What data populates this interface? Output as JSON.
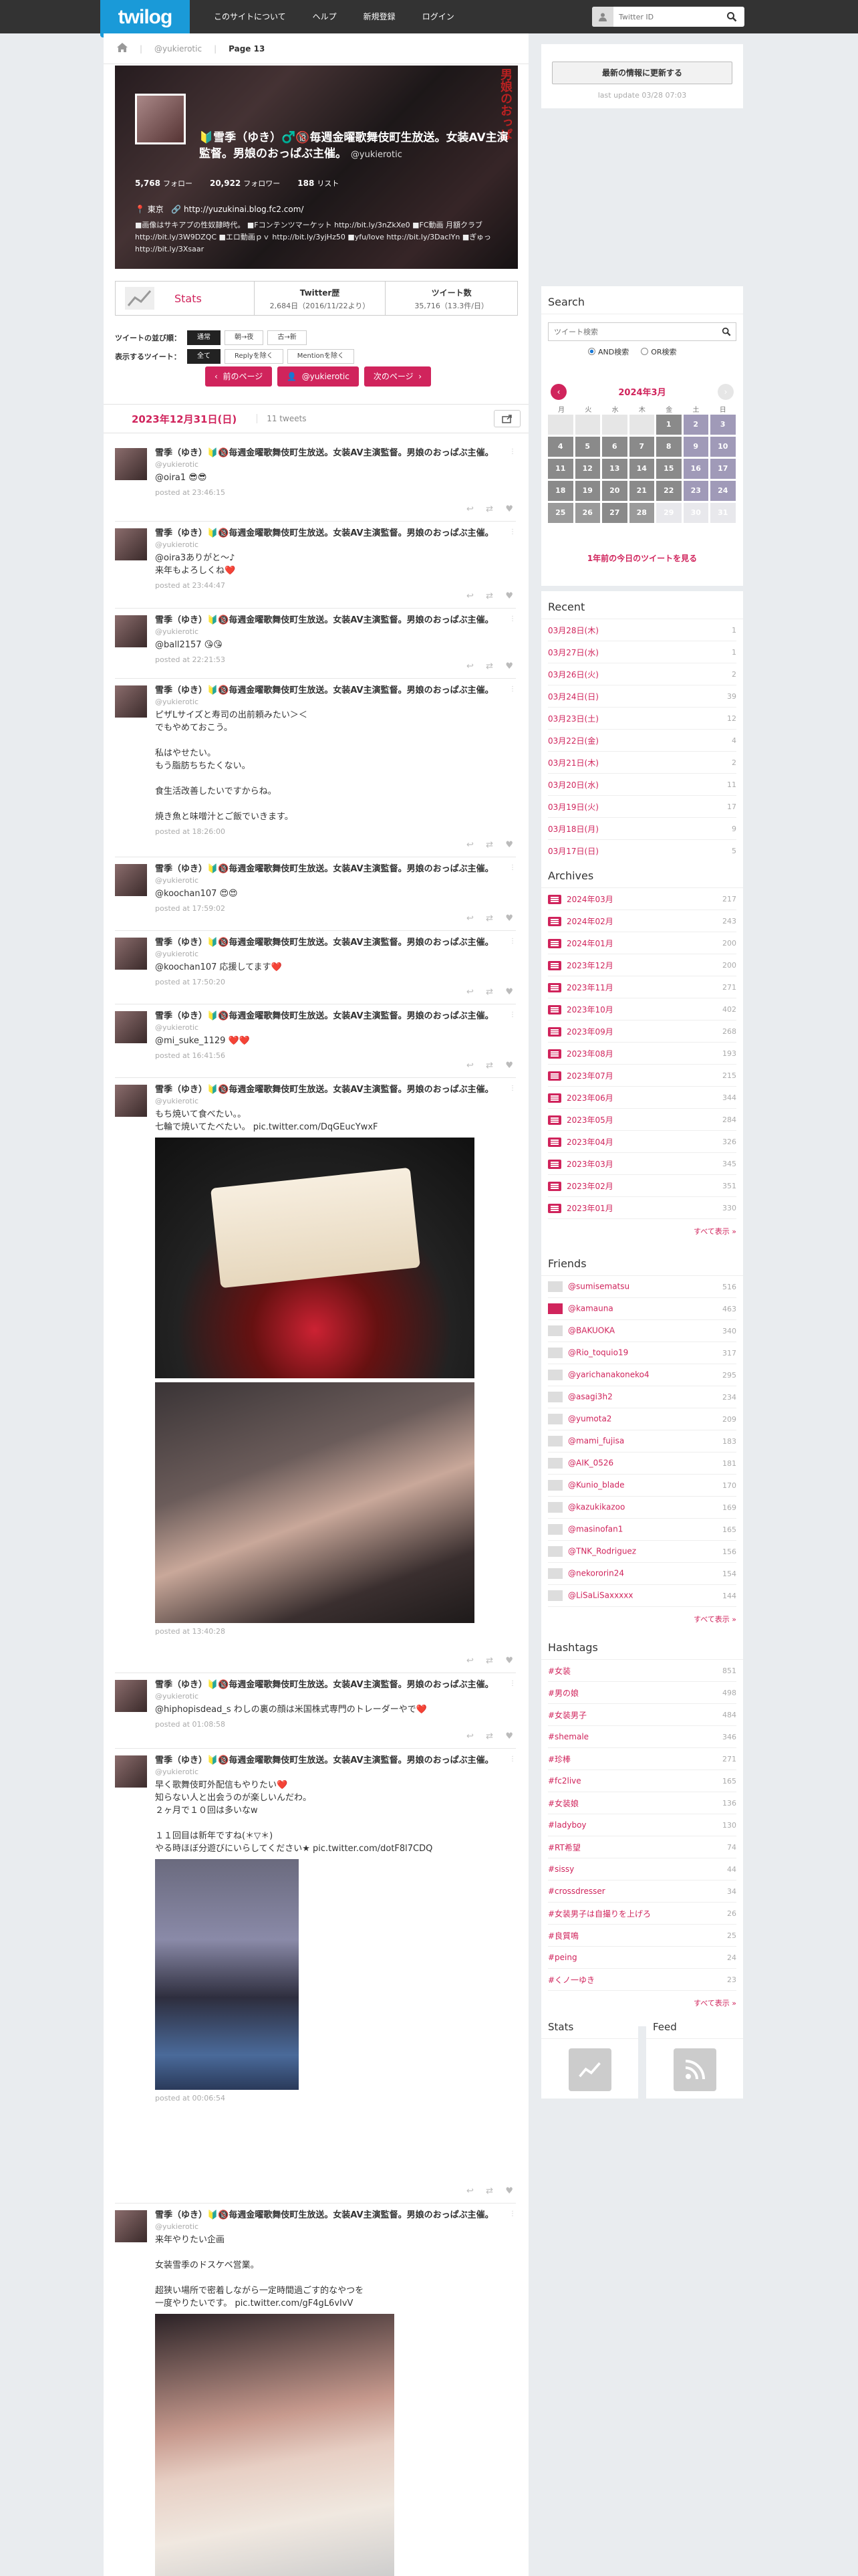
{
  "header": {
    "logo": "twilog",
    "nav": [
      "このサイトについて",
      "ヘルプ",
      "新規登録",
      "ログイン"
    ],
    "search_placeholder": "Twitter ID"
  },
  "breadcrumb": {
    "user": "@yukierotic",
    "page": "Page 13"
  },
  "profile": {
    "name": "🔰雪季（ゆき）♂️🔞毎週金曜歌舞伎町生放送。女装AV主演監督。男娘のおっぱぶ主催。",
    "screen_name": "@yukierotic",
    "follow_count": "5,768",
    "follow_label": "フォロー",
    "follower_count": "20,922",
    "follower_label": "フォロワー",
    "list_count": "188",
    "list_label": "リスト",
    "location": "東京",
    "url": "http://yuzukinai.blog.fc2.com/",
    "bio": "■画像はサキアプの性奴隷時代。 ■Fコンテンツマーケット http://bit.ly/3nZkXe0 ■FC動画 月額クラブhttp://bit.ly/3W9DZQC ■エロ動画ｐｖ http://bit.ly/3yjHz50 ■yfu/love http://bit.ly/3DacIYn ■ぎゅっ http://bit.ly/3Xsaar",
    "overlay_text": "男娘のおっぱ"
  },
  "statsbar": {
    "label": "Stats",
    "col1_title": "Twitter歴",
    "col1_value": "2,684日（2016/11/22より）",
    "col2_title": "ツイート数",
    "col2_value": "35,716（13.3件/日）"
  },
  "options": {
    "order_label": "ツイートの並び順：",
    "order_opts": [
      "通常",
      "朝→夜",
      "古→新"
    ],
    "show_label": "表示するツイート：",
    "show_opts": [
      "全て",
      "Replyを除く",
      "Mentionを除く"
    ]
  },
  "pager": {
    "prev": "前のページ",
    "user": "@yukierotic",
    "next": "次のページ"
  },
  "day": {
    "date": "2023年12月31日(日)",
    "count": "11 tweets"
  },
  "tweets": [
    {
      "name": "雪季（ゆき）🔰🔞毎週金曜歌舞伎町生放送。女装AV主演監督。男娘のおっぱぶ主催。",
      "sn": "@yukierotic",
      "text": "@oira1 😎😎",
      "posted": "posted at 23:46:15"
    },
    {
      "name": "雪季（ゆき）🔰🔞毎週金曜歌舞伎町生放送。女装AV主演監督。男娘のおっぱぶ主催。",
      "sn": "@yukierotic",
      "text": "@oira3ありがと～♪\n来年もよろしくね❤️",
      "posted": "posted at 23:44:47"
    },
    {
      "name": "雪季（ゆき）🔰🔞毎週金曜歌舞伎町生放送。女装AV主演監督。男娘のおっぱぶ主催。",
      "sn": "@yukierotic",
      "text": "@ball2157 😘😘",
      "posted": "posted at 22:21:53"
    },
    {
      "name": "雪季（ゆき）🔰🔞毎週金曜歌舞伎町生放送。女装AV主演監督。男娘のおっぱぶ主催。",
      "sn": "@yukierotic",
      "text": "ピザLサイズと寿司の出前頼みたい＞＜\nでもやめておこう。\n\n私はやせたい。\nもう脂肪ちちたくない。\n\n食生活改善したいですからね。\n\n焼き魚と味噌汁とご飯でいきます。",
      "posted": "posted at 18:26:00"
    },
    {
      "name": "雪季（ゆき）🔰🔞毎週金曜歌舞伎町生放送。女装AV主演監督。男娘のおっぱぶ主催。",
      "sn": "@yukierotic",
      "text": "@koochan107 😍😍",
      "posted": "posted at 17:59:02"
    },
    {
      "name": "雪季（ゆき）🔰🔞毎週金曜歌舞伎町生放送。女装AV主演監督。男娘のおっぱぶ主催。",
      "sn": "@yukierotic",
      "text": "@koochan107 応援してます❤️",
      "posted": "posted at 17:50:20"
    },
    {
      "name": "雪季（ゆき）🔰🔞毎週金曜歌舞伎町生放送。女装AV主演監督。男娘のおっぱぶ主催。",
      "sn": "@yukierotic",
      "text": "@mi_suke_1129 ❤️❤️",
      "posted": "posted at 16:41:56"
    },
    {
      "name": "雪季（ゆき）🔰🔞毎週金曜歌舞伎町生放送。女装AV主演監督。男娘のおっぱぶ主催。",
      "sn": "@yukierotic",
      "text": "もち焼いて食べたい。。\n七輪で焼いてたべたい。 pic.twitter.com/DqGEucYwxF",
      "posted": "posted at 13:40:28"
    },
    {
      "name": "雪季（ゆき）🔰🔞毎週金曜歌舞伎町生放送。女装AV主演監督。男娘のおっぱぶ主催。",
      "sn": "@yukierotic",
      "text": "@hiphopisdead_s わしの裏の顔は米国株式専門のトレーダーやで❤️",
      "posted": "posted at 01:08:58"
    },
    {
      "name": "雪季（ゆき）🔰🔞毎週金曜歌舞伎町生放送。女装AV主演監督。男娘のおっぱぶ主催。",
      "sn": "@yukierotic",
      "text": "早く歌舞伎町外配信もやりたい❤️\n知らない人と出会うのが楽しいんだわ。\n２ヶ月で１０回は多いなw\n\n１１回目は新年ですね(＊▽＊)\nやる時ほぼ分遊びにいらしてください★ pic.twitter.com/dotF8l7CDQ",
      "posted": "posted at 00:06:54"
    },
    {
      "name": "雪季（ゆき）🔰🔞毎週金曜歌舞伎町生放送。女装AV主演監督。男娘のおっぱぶ主催。",
      "sn": "@yukierotic",
      "text": "来年やりたい企画\n\n女装雪季のドスケベ営業。\n\n超狭い場所で密着しながら一定時間過ごす的なやつを\n一度やりたいです。 pic.twitter.com/gF4gL6vIvV",
      "posted": ""
    }
  ],
  "sidebar": {
    "update_btn": "最新の情報に更新する",
    "last_update": "last update 03/28 07:03",
    "search_title": "Search",
    "search_placeholder": "ツイート検索",
    "and_label": "AND検索",
    "or_label": "OR検索",
    "cal_title": "2024年3月",
    "cal_dows": [
      "月",
      "火",
      "水",
      "木",
      "金",
      "土",
      "日"
    ],
    "cal_link": "1年前の今日のツイートを見る",
    "recent_title": "Recent",
    "recent": [
      {
        "d": "03月28日(木)",
        "c": "1"
      },
      {
        "d": "03月27日(水)",
        "c": "1"
      },
      {
        "d": "03月26日(火)",
        "c": "2"
      },
      {
        "d": "03月24日(日)",
        "c": "39"
      },
      {
        "d": "03月23日(土)",
        "c": "12"
      },
      {
        "d": "03月22日(金)",
        "c": "4"
      },
      {
        "d": "03月21日(木)",
        "c": "2"
      },
      {
        "d": "03月20日(水)",
        "c": "11"
      },
      {
        "d": "03月19日(火)",
        "c": "17"
      },
      {
        "d": "03月18日(月)",
        "c": "9"
      },
      {
        "d": "03月17日(日)",
        "c": "5"
      }
    ],
    "archives_title": "Archives",
    "archives": [
      {
        "d": "2024年03月",
        "c": "217"
      },
      {
        "d": "2024年02月",
        "c": "243"
      },
      {
        "d": "2024年01月",
        "c": "200"
      },
      {
        "d": "2023年12月",
        "c": "200"
      },
      {
        "d": "2023年11月",
        "c": "271"
      },
      {
        "d": "2023年10月",
        "c": "402"
      },
      {
        "d": "2023年09月",
        "c": "268"
      },
      {
        "d": "2023年08月",
        "c": "193"
      },
      {
        "d": "2023年07月",
        "c": "215"
      },
      {
        "d": "2023年06月",
        "c": "344"
      },
      {
        "d": "2023年05月",
        "c": "284"
      },
      {
        "d": "2023年04月",
        "c": "326"
      },
      {
        "d": "2023年03月",
        "c": "345"
      },
      {
        "d": "2023年02月",
        "c": "351"
      },
      {
        "d": "2023年01月",
        "c": "330"
      }
    ],
    "more": "すべて表示 »",
    "friends_title": "Friends",
    "friends": [
      {
        "n": "@sumisematsu",
        "c": "516"
      },
      {
        "n": "@kamauna",
        "c": "463"
      },
      {
        "n": "@BAKUOKA",
        "c": "340"
      },
      {
        "n": "@Rio_toquio19",
        "c": "317"
      },
      {
        "n": "@yarichanakoneko4",
        "c": "295"
      },
      {
        "n": "@asagi3h2",
        "c": "234"
      },
      {
        "n": "@yumota2",
        "c": "209"
      },
      {
        "n": "@mami_fujisa",
        "c": "183"
      },
      {
        "n": "@AIK_0526",
        "c": "181"
      },
      {
        "n": "@Kunio_blade",
        "c": "170"
      },
      {
        "n": "@kazukikazoo",
        "c": "169"
      },
      {
        "n": "@masinofan1",
        "c": "165"
      },
      {
        "n": "@TNK_Rodriguez",
        "c": "156"
      },
      {
        "n": "@nekororin24",
        "c": "154"
      },
      {
        "n": "@LiSaLiSaxxxxx",
        "c": "144"
      }
    ],
    "hashtags_title": "Hashtags",
    "hashtags": [
      {
        "n": "#女装",
        "c": "851"
      },
      {
        "n": "#男の娘",
        "c": "498"
      },
      {
        "n": "#女装男子",
        "c": "484"
      },
      {
        "n": "#shemale",
        "c": "346"
      },
      {
        "n": "#珍棒",
        "c": "271"
      },
      {
        "n": "#fc2live",
        "c": "165"
      },
      {
        "n": "#女装娘",
        "c": "136"
      },
      {
        "n": "#ladyboy",
        "c": "130"
      },
      {
        "n": "#RT希望",
        "c": "74"
      },
      {
        "n": "#sissy",
        "c": "44"
      },
      {
        "n": "#crossdresser",
        "c": "34"
      },
      {
        "n": "#女装男子は自撮りを上げろ",
        "c": "26"
      },
      {
        "n": "#良質鳴",
        "c": "25"
      },
      {
        "n": "#peing",
        "c": "24"
      },
      {
        "n": "#くノ一ゆき",
        "c": "23"
      }
    ],
    "stats_title": "Stats",
    "feed_title": "Feed"
  },
  "calendar_days": [
    [
      "",
      "",
      "",
      "",
      "1",
      "2",
      "3"
    ],
    [
      "4",
      "5",
      "6",
      "7",
      "8",
      "9",
      "10"
    ],
    [
      "11",
      "12",
      "13",
      "14",
      "15",
      "16",
      "17"
    ],
    [
      "18",
      "19",
      "20",
      "21",
      "22",
      "23",
      "24"
    ],
    [
      "25",
      "26",
      "27",
      "28",
      "29",
      "30",
      "31"
    ]
  ],
  "colors": {
    "accent": "#d0245c",
    "logo_blue": "#1a9ad8",
    "dark": "#333333",
    "cal_gray": "#888888",
    "cal_purple": "#9c94b8"
  }
}
